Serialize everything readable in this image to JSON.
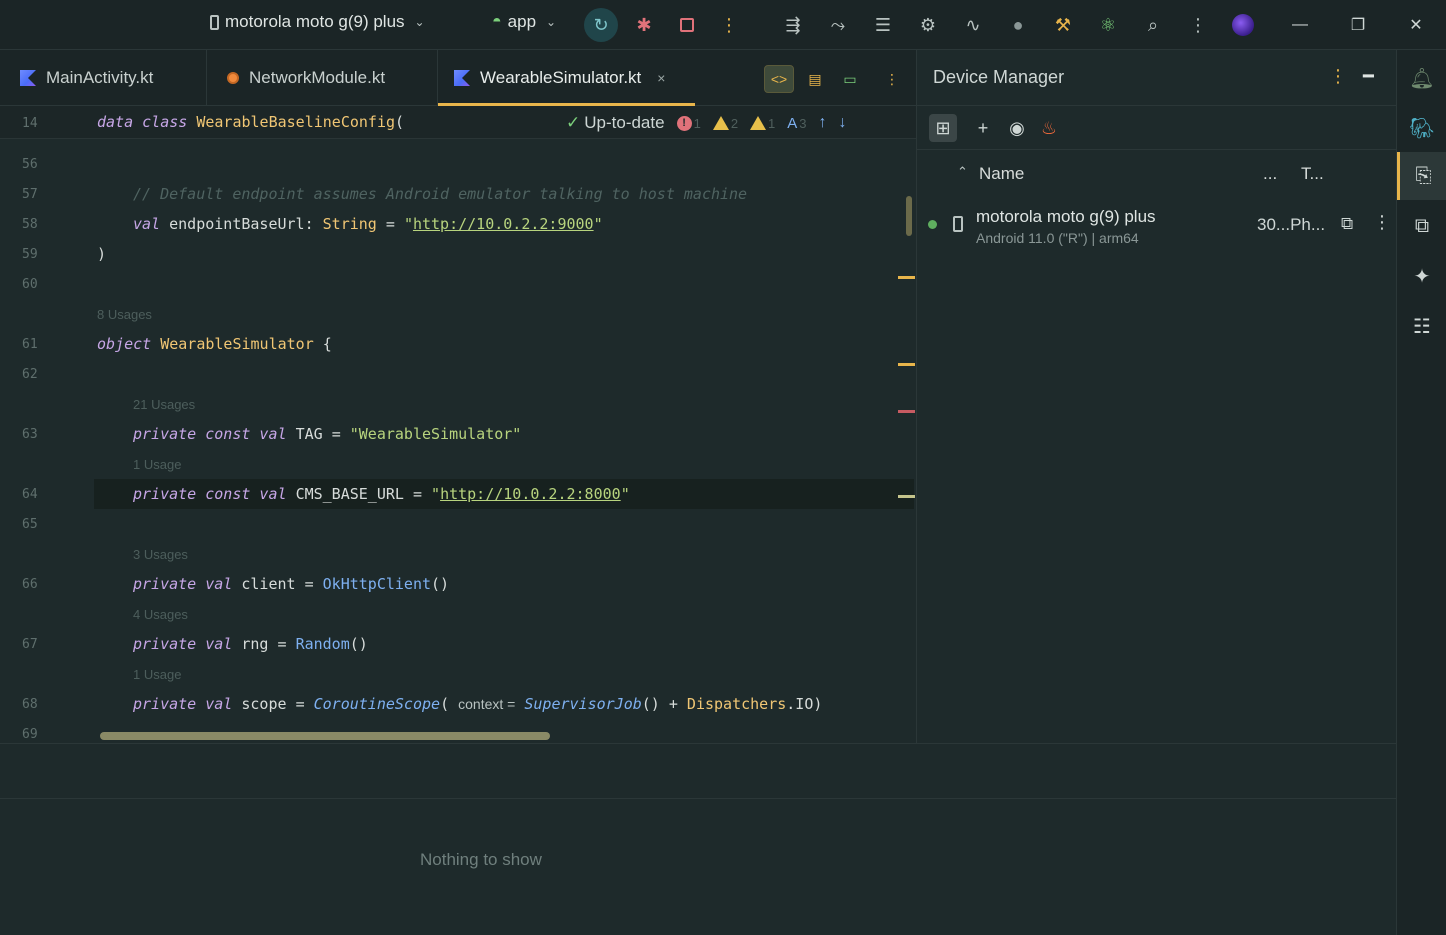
{
  "titlebar": {
    "device": "motorola moto g(9) plus",
    "run_config": "app"
  },
  "tabs": [
    {
      "label": "MainActivity.kt"
    },
    {
      "label": "NetworkModule.kt"
    },
    {
      "label": "WearableSimulator.kt",
      "close": "×"
    }
  ],
  "editor": {
    "sticky_line_no": "14",
    "sticky_code": {
      "kw": "data class",
      "name": "WearableBaselineConfig",
      "paren": "("
    },
    "status": {
      "label": "Up-to-date",
      "errors": "1",
      "warnings": "2",
      "weak_warnings": "1",
      "typos": "3"
    },
    "lines": [
      {
        "no": "56"
      },
      {
        "no": "57",
        "comment": "// Default endpoint assumes Android emulator talking to host machine"
      },
      {
        "no": "58",
        "kw": "val",
        "name": "endpointBaseUrl",
        "colon": ":",
        "type": "String",
        "eq": "=",
        "url": "http://10.0.2.2:9000"
      },
      {
        "no": "59",
        "text": ")"
      },
      {
        "no": "60"
      },
      {
        "no": "61",
        "kw": "object",
        "name": "WearableSimulator",
        "brace": "{",
        "usages": "8 Usages"
      },
      {
        "no": "62"
      },
      {
        "no": "63",
        "kw": "private const val",
        "name": "TAG",
        "eq": "=",
        "str": "\"WearableSimulator\"",
        "usages": "21 Usages"
      },
      {
        "no": "64",
        "kw": "private const val",
        "name": "CMS_BASE_URL",
        "eq": "=",
        "url": "http://10.0.2.2:8000",
        "usages": "1 Usage"
      },
      {
        "no": "65"
      },
      {
        "no": "66",
        "kw": "private val",
        "name": "client",
        "eq": "=",
        "call": "OkHttpClient",
        "args": "()",
        "usages": "3 Usages"
      },
      {
        "no": "67",
        "kw": "private val",
        "name": "rng",
        "eq": "=",
        "call": "Random",
        "args": "()",
        "usages": "4 Usages"
      },
      {
        "no": "68",
        "kw": "private val",
        "name": "scope",
        "eq": "=",
        "call": "CoroutineScope",
        "open": "(",
        "param": "context =",
        "arg1": "SupervisorJob",
        "arg1p": "()",
        "plus": "+",
        "arg2": "Dispatchers",
        "dot": ".",
        "arg2b": "IO",
        "close": ")",
        "usages": "1 Usage"
      },
      {
        "no": "69"
      }
    ]
  },
  "device_manager": {
    "title": "Device Manager",
    "columns": {
      "name": "Name",
      "api": "...",
      "type": "T..."
    },
    "devices": [
      {
        "name": "motorola moto g(9) plus",
        "details": "Android 11.0 (\"R\") | arm64",
        "type": "30...Ph..."
      }
    ]
  },
  "bottom_panel": {
    "empty": "Nothing to show"
  },
  "colors": {
    "accent": "#e8b54b",
    "background": "#1e2a2b",
    "keyword": "#c6a6e6",
    "string": "#b8d47e",
    "error": "#e0727a"
  }
}
